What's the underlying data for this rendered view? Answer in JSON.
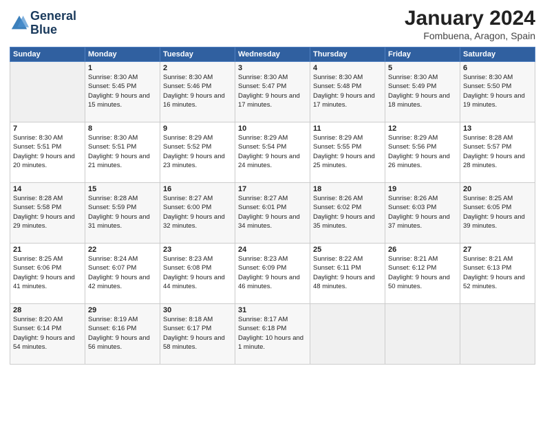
{
  "header": {
    "logo_line1": "General",
    "logo_line2": "Blue",
    "title": "January 2024",
    "location": "Fombuena, Aragon, Spain"
  },
  "days_of_week": [
    "Sunday",
    "Monday",
    "Tuesday",
    "Wednesday",
    "Thursday",
    "Friday",
    "Saturday"
  ],
  "weeks": [
    [
      {
        "day": "",
        "empty": true
      },
      {
        "day": "1",
        "rise": "8:30 AM",
        "set": "5:45 PM",
        "daylight": "9 hours and 15 minutes."
      },
      {
        "day": "2",
        "rise": "8:30 AM",
        "set": "5:46 PM",
        "daylight": "9 hours and 16 minutes."
      },
      {
        "day": "3",
        "rise": "8:30 AM",
        "set": "5:47 PM",
        "daylight": "9 hours and 17 minutes."
      },
      {
        "day": "4",
        "rise": "8:30 AM",
        "set": "5:48 PM",
        "daylight": "9 hours and 17 minutes."
      },
      {
        "day": "5",
        "rise": "8:30 AM",
        "set": "5:49 PM",
        "daylight": "9 hours and 18 minutes."
      },
      {
        "day": "6",
        "rise": "8:30 AM",
        "set": "5:50 PM",
        "daylight": "9 hours and 19 minutes."
      }
    ],
    [
      {
        "day": "7",
        "rise": "8:30 AM",
        "set": "5:51 PM",
        "daylight": "9 hours and 20 minutes."
      },
      {
        "day": "8",
        "rise": "8:30 AM",
        "set": "5:51 PM",
        "daylight": "9 hours and 21 minutes."
      },
      {
        "day": "9",
        "rise": "8:29 AM",
        "set": "5:52 PM",
        "daylight": "9 hours and 23 minutes."
      },
      {
        "day": "10",
        "rise": "8:29 AM",
        "set": "5:54 PM",
        "daylight": "9 hours and 24 minutes."
      },
      {
        "day": "11",
        "rise": "8:29 AM",
        "set": "5:55 PM",
        "daylight": "9 hours and 25 minutes."
      },
      {
        "day": "12",
        "rise": "8:29 AM",
        "set": "5:56 PM",
        "daylight": "9 hours and 26 minutes."
      },
      {
        "day": "13",
        "rise": "8:28 AM",
        "set": "5:57 PM",
        "daylight": "9 hours and 28 minutes."
      }
    ],
    [
      {
        "day": "14",
        "rise": "8:28 AM",
        "set": "5:58 PM",
        "daylight": "9 hours and 29 minutes."
      },
      {
        "day": "15",
        "rise": "8:28 AM",
        "set": "5:59 PM",
        "daylight": "9 hours and 31 minutes."
      },
      {
        "day": "16",
        "rise": "8:27 AM",
        "set": "6:00 PM",
        "daylight": "9 hours and 32 minutes."
      },
      {
        "day": "17",
        "rise": "8:27 AM",
        "set": "6:01 PM",
        "daylight": "9 hours and 34 minutes."
      },
      {
        "day": "18",
        "rise": "8:26 AM",
        "set": "6:02 PM",
        "daylight": "9 hours and 35 minutes."
      },
      {
        "day": "19",
        "rise": "8:26 AM",
        "set": "6:03 PM",
        "daylight": "9 hours and 37 minutes."
      },
      {
        "day": "20",
        "rise": "8:25 AM",
        "set": "6:05 PM",
        "daylight": "9 hours and 39 minutes."
      }
    ],
    [
      {
        "day": "21",
        "rise": "8:25 AM",
        "set": "6:06 PM",
        "daylight": "9 hours and 41 minutes."
      },
      {
        "day": "22",
        "rise": "8:24 AM",
        "set": "6:07 PM",
        "daylight": "9 hours and 42 minutes."
      },
      {
        "day": "23",
        "rise": "8:23 AM",
        "set": "6:08 PM",
        "daylight": "9 hours and 44 minutes."
      },
      {
        "day": "24",
        "rise": "8:23 AM",
        "set": "6:09 PM",
        "daylight": "9 hours and 46 minutes."
      },
      {
        "day": "25",
        "rise": "8:22 AM",
        "set": "6:11 PM",
        "daylight": "9 hours and 48 minutes."
      },
      {
        "day": "26",
        "rise": "8:21 AM",
        "set": "6:12 PM",
        "daylight": "9 hours and 50 minutes."
      },
      {
        "day": "27",
        "rise": "8:21 AM",
        "set": "6:13 PM",
        "daylight": "9 hours and 52 minutes."
      }
    ],
    [
      {
        "day": "28",
        "rise": "8:20 AM",
        "set": "6:14 PM",
        "daylight": "9 hours and 54 minutes."
      },
      {
        "day": "29",
        "rise": "8:19 AM",
        "set": "6:16 PM",
        "daylight": "9 hours and 56 minutes."
      },
      {
        "day": "30",
        "rise": "8:18 AM",
        "set": "6:17 PM",
        "daylight": "9 hours and 58 minutes."
      },
      {
        "day": "31",
        "rise": "8:17 AM",
        "set": "6:18 PM",
        "daylight": "10 hours and 1 minute."
      },
      {
        "day": "",
        "empty": true
      },
      {
        "day": "",
        "empty": true
      },
      {
        "day": "",
        "empty": true
      }
    ]
  ]
}
